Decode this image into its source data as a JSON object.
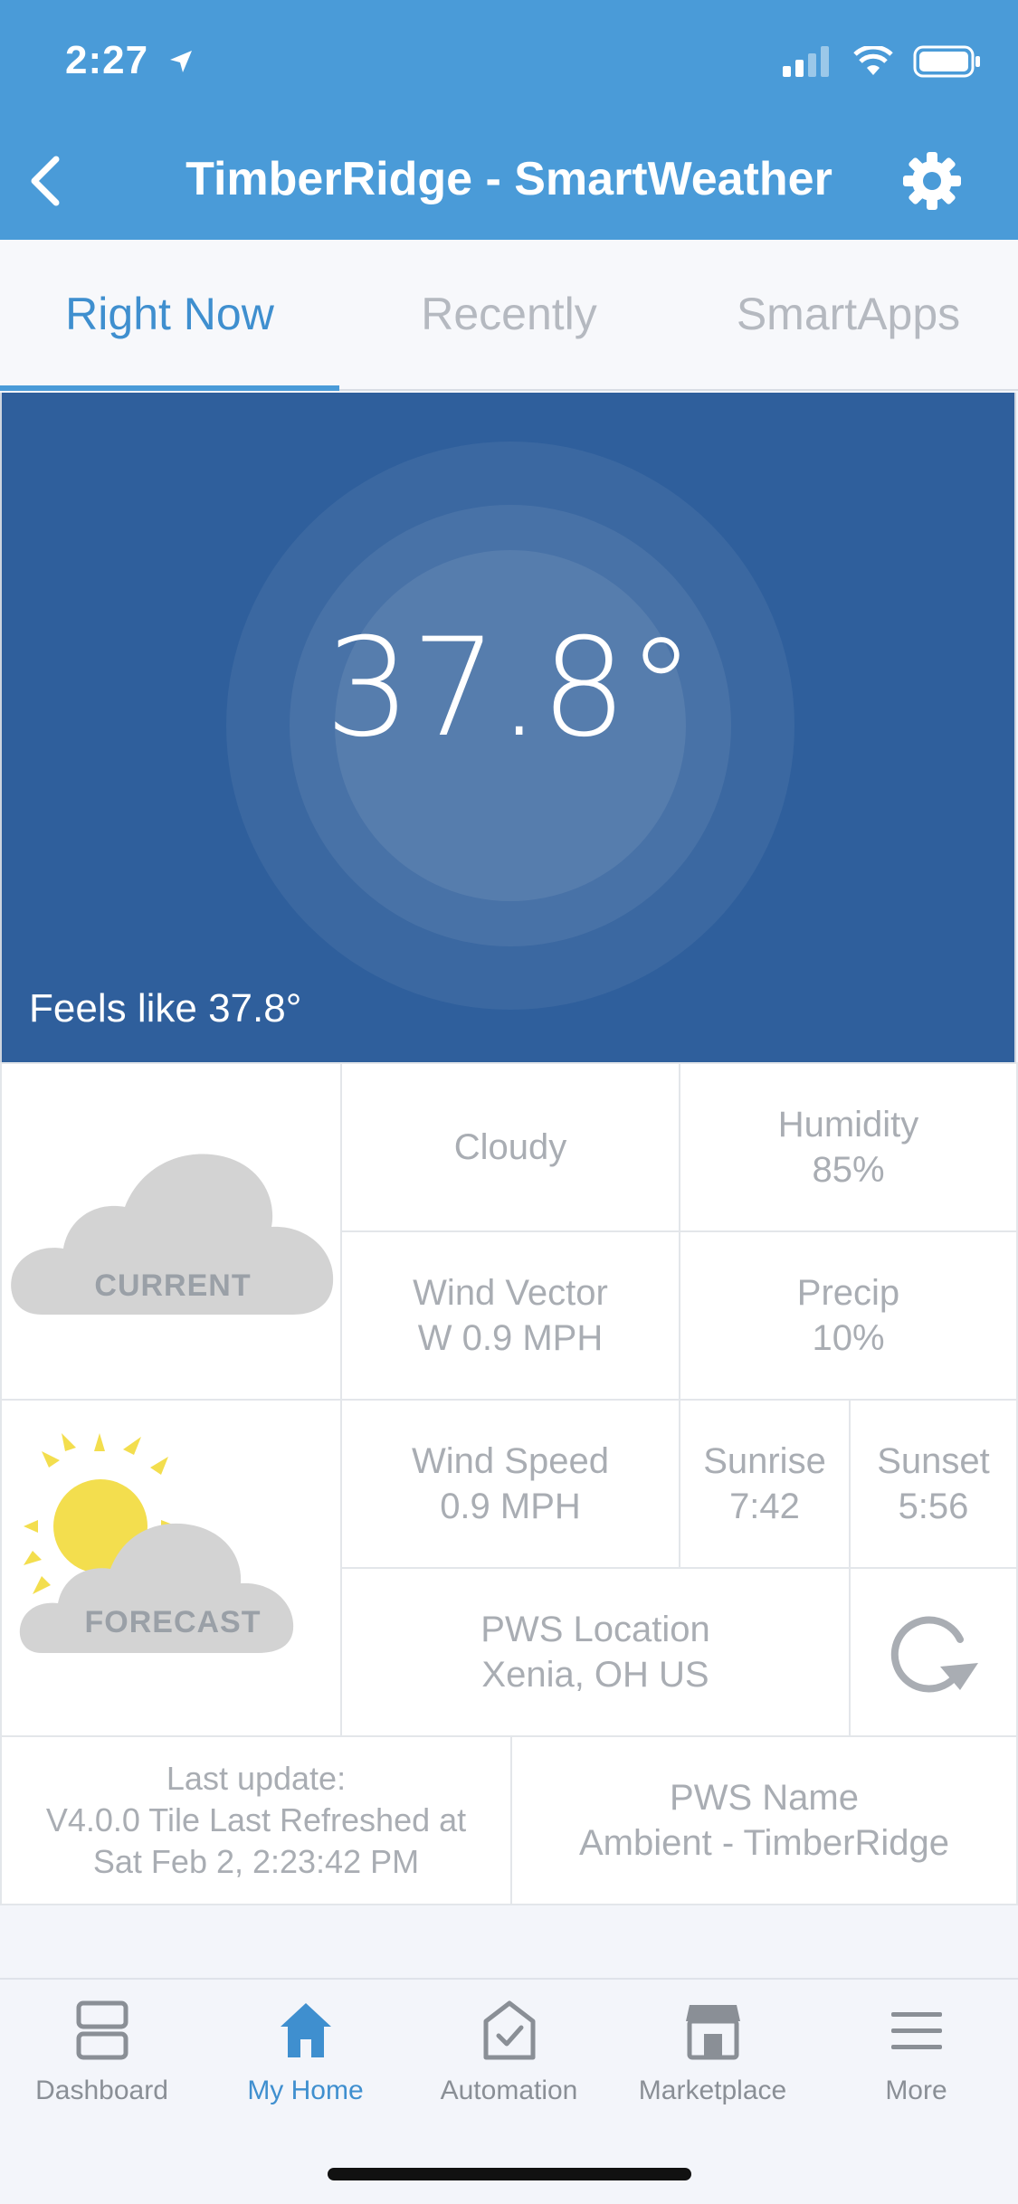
{
  "status": {
    "time": "2:27"
  },
  "header": {
    "title": "TimberRidge - SmartWeather"
  },
  "tabs": [
    {
      "label": "Right Now"
    },
    {
      "label": "Recently"
    },
    {
      "label": "SmartApps"
    }
  ],
  "hero": {
    "temperature": "37.8°",
    "feels_like": "Feels like 37.8°"
  },
  "tiles": {
    "current_label": "CURRENT",
    "forecast_label": "FORECAST",
    "condition": "Cloudy",
    "humidity_label": "Humidity",
    "humidity_value": "85%",
    "wind_vector_label": "Wind Vector",
    "wind_vector_value": "W 0.9 MPH",
    "precip_label": "Precip",
    "precip_value": "10%",
    "wind_speed_label": "Wind Speed",
    "wind_speed_value": "0.9 MPH",
    "sunrise_label": "Sunrise",
    "sunrise_value": "7:42",
    "sunset_label": "Sunset",
    "sunset_value": "5:56",
    "pws_location_label": "PWS Location",
    "pws_location_value": "Xenia, OH US",
    "last_update_line1": "Last update:",
    "last_update_line2": "V4.0.0 Tile Last Refreshed at",
    "last_update_line3": "Sat Feb 2, 2:23:42 PM",
    "pws_name_label": "PWS Name",
    "pws_name_value": "Ambient - TimberRidge"
  },
  "bottom_nav": [
    {
      "label": "Dashboard",
      "icon": "dashboard-icon"
    },
    {
      "label": "My Home",
      "icon": "home-icon"
    },
    {
      "label": "Automation",
      "icon": "automation-icon"
    },
    {
      "label": "Marketplace",
      "icon": "marketplace-icon"
    },
    {
      "label": "More",
      "icon": "menu-icon"
    }
  ],
  "colors": {
    "header": "#4a9bd8",
    "hero": "#2f5f9c",
    "active": "#3f8fcf"
  }
}
